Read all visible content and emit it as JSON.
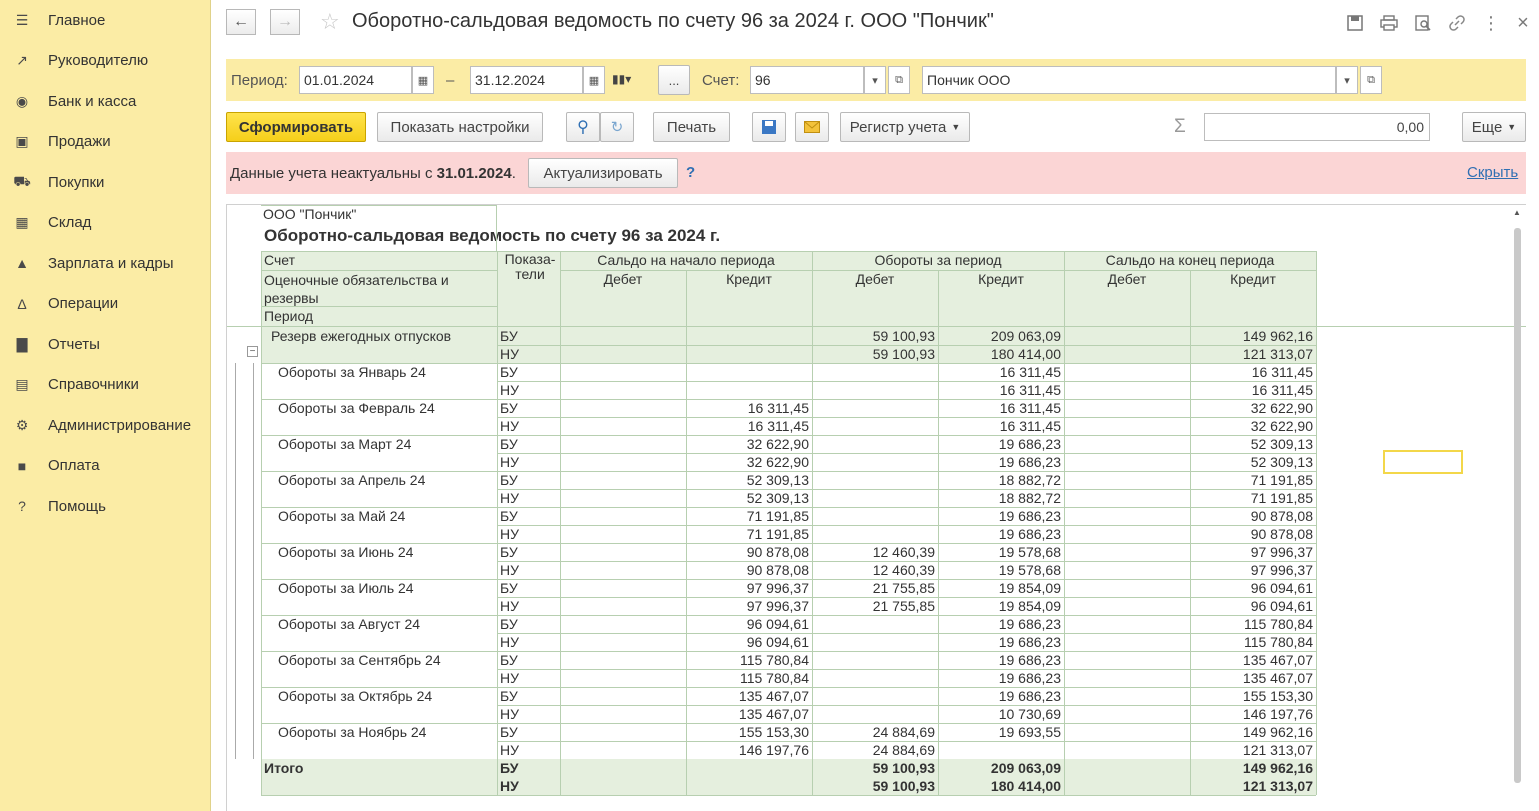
{
  "sidebar": {
    "items": [
      {
        "label": "Главное",
        "icon": "menu-icon"
      },
      {
        "label": "Руководителю",
        "icon": "trend-icon"
      },
      {
        "label": "Банк и касса",
        "icon": "coin-icon"
      },
      {
        "label": "Продажи",
        "icon": "bag-icon"
      },
      {
        "label": "Покупки",
        "icon": "cart-icon"
      },
      {
        "label": "Склад",
        "icon": "warehouse-icon"
      },
      {
        "label": "Зарплата и кадры",
        "icon": "person-icon"
      },
      {
        "label": "Операции",
        "icon": "operations-icon"
      },
      {
        "label": "Отчеты",
        "icon": "chart-icon"
      },
      {
        "label": "Справочники",
        "icon": "books-icon"
      },
      {
        "label": "Администрирование",
        "icon": "gear-icon"
      },
      {
        "label": "Оплата",
        "icon": "wallet-icon"
      },
      {
        "label": "Помощь",
        "icon": "help-icon"
      }
    ]
  },
  "header": {
    "title": "Оборотно-сальдовая ведомость по счету 96 за 2024 г. ООО \"Пончик\""
  },
  "params": {
    "period_label": "Период:",
    "date_from": "01.01.2024",
    "dash": "–",
    "date_to": "31.12.2024",
    "ellipsis": "...",
    "account_label": "Счет:",
    "account": "96",
    "organization": "Пончик ООО"
  },
  "toolbar": {
    "generate": "Сформировать",
    "settings": "Показать настройки",
    "print": "Печать",
    "register": "Регистр учета",
    "sum_symbol": "Σ",
    "sum_value": "0,00",
    "more": "Еще"
  },
  "warning": {
    "text": "Данные учета неактуальны с ",
    "date": "31.01.2024",
    "dot": ".",
    "update": "Актуализировать",
    "question": "?",
    "hide": "Скрыть"
  },
  "report": {
    "org": "ООО \"Пончик\"",
    "title": "Оборотно-сальдовая ведомость по счету 96 за 2024 г.",
    "headers": {
      "account": "Счет",
      "subconto": "Оценочные обязательства и резервы",
      "period": "Период",
      "indicators": "Показа-\nтели",
      "opening": "Сальдо на начало периода",
      "turnover": "Обороты за период",
      "closing": "Сальдо на конец периода",
      "debit": "Дебет",
      "credit": "Кредит"
    },
    "group": {
      "name": "Резерв ежегодных отпусков",
      "rows": [
        {
          "ind": "БУ",
          "od": "",
          "oc": "",
          "td": "59 100,93",
          "tc": "209 063,09",
          "cd": "",
          "cc": "149 962,16"
        },
        {
          "ind": "НУ",
          "od": "",
          "oc": "",
          "td": "59 100,93",
          "tc": "180 414,00",
          "cd": "",
          "cc": "121 313,07"
        }
      ]
    },
    "periods": [
      {
        "name": "Обороты за Январь 24",
        "rows": [
          {
            "ind": "БУ",
            "od": "",
            "oc": "",
            "td": "",
            "tc": "16 311,45",
            "cd": "",
            "cc": "16 311,45"
          },
          {
            "ind": "НУ",
            "od": "",
            "oc": "",
            "td": "",
            "tc": "16 311,45",
            "cd": "",
            "cc": "16 311,45"
          }
        ]
      },
      {
        "name": "Обороты за Февраль 24",
        "rows": [
          {
            "ind": "БУ",
            "od": "",
            "oc": "16 311,45",
            "td": "",
            "tc": "16 311,45",
            "cd": "",
            "cc": "32 622,90"
          },
          {
            "ind": "НУ",
            "od": "",
            "oc": "16 311,45",
            "td": "",
            "tc": "16 311,45",
            "cd": "",
            "cc": "32 622,90"
          }
        ]
      },
      {
        "name": "Обороты за Март 24",
        "rows": [
          {
            "ind": "БУ",
            "od": "",
            "oc": "32 622,90",
            "td": "",
            "tc": "19 686,23",
            "cd": "",
            "cc": "52 309,13"
          },
          {
            "ind": "НУ",
            "od": "",
            "oc": "32 622,90",
            "td": "",
            "tc": "19 686,23",
            "cd": "",
            "cc": "52 309,13"
          }
        ]
      },
      {
        "name": "Обороты за Апрель 24",
        "rows": [
          {
            "ind": "БУ",
            "od": "",
            "oc": "52 309,13",
            "td": "",
            "tc": "18 882,72",
            "cd": "",
            "cc": "71 191,85"
          },
          {
            "ind": "НУ",
            "od": "",
            "oc": "52 309,13",
            "td": "",
            "tc": "18 882,72",
            "cd": "",
            "cc": "71 191,85"
          }
        ]
      },
      {
        "name": "Обороты за Май 24",
        "rows": [
          {
            "ind": "БУ",
            "od": "",
            "oc": "71 191,85",
            "td": "",
            "tc": "19 686,23",
            "cd": "",
            "cc": "90 878,08"
          },
          {
            "ind": "НУ",
            "od": "",
            "oc": "71 191,85",
            "td": "",
            "tc": "19 686,23",
            "cd": "",
            "cc": "90 878,08"
          }
        ]
      },
      {
        "name": "Обороты за Июнь 24",
        "rows": [
          {
            "ind": "БУ",
            "od": "",
            "oc": "90 878,08",
            "td": "12 460,39",
            "tc": "19 578,68",
            "cd": "",
            "cc": "97 996,37"
          },
          {
            "ind": "НУ",
            "od": "",
            "oc": "90 878,08",
            "td": "12 460,39",
            "tc": "19 578,68",
            "cd": "",
            "cc": "97 996,37"
          }
        ]
      },
      {
        "name": "Обороты за Июль 24",
        "rows": [
          {
            "ind": "БУ",
            "od": "",
            "oc": "97 996,37",
            "td": "21 755,85",
            "tc": "19 854,09",
            "cd": "",
            "cc": "96 094,61"
          },
          {
            "ind": "НУ",
            "od": "",
            "oc": "97 996,37",
            "td": "21 755,85",
            "tc": "19 854,09",
            "cd": "",
            "cc": "96 094,61"
          }
        ]
      },
      {
        "name": "Обороты за Август 24",
        "rows": [
          {
            "ind": "БУ",
            "od": "",
            "oc": "96 094,61",
            "td": "",
            "tc": "19 686,23",
            "cd": "",
            "cc": "115 780,84"
          },
          {
            "ind": "НУ",
            "od": "",
            "oc": "96 094,61",
            "td": "",
            "tc": "19 686,23",
            "cd": "",
            "cc": "115 780,84"
          }
        ]
      },
      {
        "name": "Обороты за Сентябрь 24",
        "rows": [
          {
            "ind": "БУ",
            "od": "",
            "oc": "115 780,84",
            "td": "",
            "tc": "19 686,23",
            "cd": "",
            "cc": "135 467,07"
          },
          {
            "ind": "НУ",
            "od": "",
            "oc": "115 780,84",
            "td": "",
            "tc": "19 686,23",
            "cd": "",
            "cc": "135 467,07"
          }
        ]
      },
      {
        "name": "Обороты за Октябрь 24",
        "rows": [
          {
            "ind": "БУ",
            "od": "",
            "oc": "135 467,07",
            "td": "",
            "tc": "19 686,23",
            "cd": "",
            "cc": "155 153,30"
          },
          {
            "ind": "НУ",
            "od": "",
            "oc": "135 467,07",
            "td": "",
            "tc": "10 730,69",
            "cd": "",
            "cc": "146 197,76"
          }
        ]
      },
      {
        "name": "Обороты за Ноябрь 24",
        "rows": [
          {
            "ind": "БУ",
            "od": "",
            "oc": "155 153,30",
            "td": "24 884,69",
            "tc": "19 693,55",
            "cd": "",
            "cc": "149 962,16"
          },
          {
            "ind": "НУ",
            "od": "",
            "oc": "146 197,76",
            "td": "24 884,69",
            "tc": "",
            "cd": "",
            "cc": "121 313,07"
          }
        ]
      }
    ],
    "total": {
      "name": "Итого",
      "rows": [
        {
          "ind": "БУ",
          "od": "",
          "oc": "",
          "td": "59 100,93",
          "tc": "209 063,09",
          "cd": "",
          "cc": "149 962,16"
        },
        {
          "ind": "НУ",
          "od": "",
          "oc": "",
          "td": "59 100,93",
          "tc": "180 414,00",
          "cd": "",
          "cc": "121 313,07"
        }
      ]
    }
  }
}
